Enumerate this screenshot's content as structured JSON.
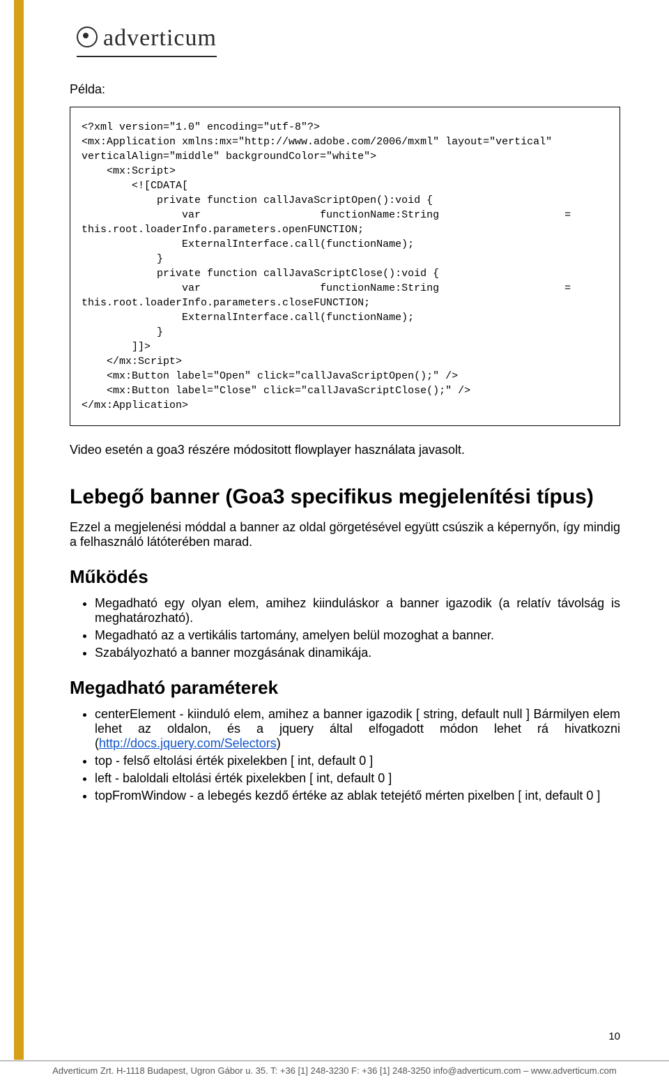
{
  "logo": {
    "word": "adverticum"
  },
  "example_label": "Példa:",
  "code": "<?xml version=\"1.0\" encoding=\"utf-8\"?>\n<mx:Application xmlns:mx=\"http://www.adobe.com/2006/mxml\" layout=\"vertical\" verticalAlign=\"middle\" backgroundColor=\"white\">\n    <mx:Script>\n        <![CDATA[\n            private function callJavaScriptOpen():void {\n                var                   functionName:String                    =\nthis.root.loaderInfo.parameters.openFUNCTION;\n                ExternalInterface.call(functionName);\n            }\n            private function callJavaScriptClose():void {\n                var                   functionName:String                    =\nthis.root.loaderInfo.parameters.closeFUNCTION;\n                ExternalInterface.call(functionName);\n            }\n        ]]>\n    </mx:Script>\n    <mx:Button label=\"Open\" click=\"callJavaScriptOpen();\" />\n    <mx:Button label=\"Close\" click=\"callJavaScriptClose();\" />\n</mx:Application>",
  "video_note": "Video esetén a goa3 részére módositott flowplayer használata javasolt.",
  "section_title": "Lebegő banner (Goa3 specifikus megjelenítési típus)",
  "section_intro": "Ezzel a megjelenési móddal a banner az oldal görgetésével együtt csúszik a képernyőn, így mindig a felhasználó látóterében marad.",
  "working_title": "Működés",
  "working_bullets": [
    "Megadható egy olyan elem, amihez kiinduláskor a banner igazodik (a relatív távolság is meghatározható).",
    "Megadható az a vertikális tartomány, amelyen belül mozoghat a banner.",
    "Szabályozható a banner mozgásának dinamikája."
  ],
  "params_title": "Megadható paraméterek",
  "params_bullets": {
    "b0_a": "centerElement - kiinduló elem, amihez a banner igazodik [ string, default null ] Bármilyen elem lehet az oldalon, és a jquery által elfogadott módon lehet rá hivatkozni (",
    "b0_link": "http://docs.jquery.com/Selectors",
    "b0_b": ")",
    "b1": "top - felső eltolási érték pixelekben [ int, default 0 ]",
    "b2": "left - baloldali eltolási érték pixelekben [ int, default 0 ]",
    "b3": "topFromWindow - a lebegés kezdő értéke az ablak tetejétő mérten pixelben [ int, default 0 ]"
  },
  "page_number": "10",
  "footer": "Adverticum Zrt. H-1118 Budapest, Ugron Gábor u. 35.  T: +36 [1] 248-3230 F: +36 [1] 248-3250  info@adverticum.com – www.adverticum.com"
}
